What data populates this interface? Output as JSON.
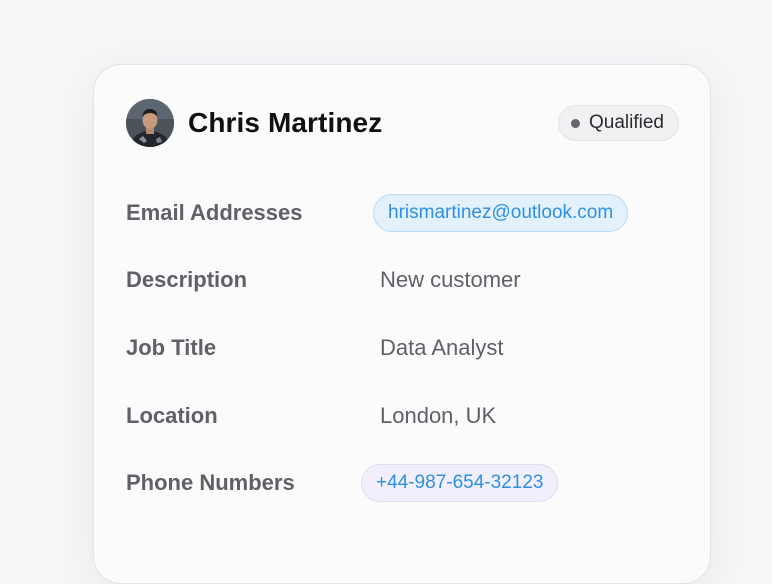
{
  "contact": {
    "name": "Chris Martinez",
    "status": "Qualified",
    "avatar_alt": "Chris Martinez profile photo"
  },
  "fields": {
    "email": {
      "label": "Email Addresses",
      "value": "hrismartinez@outlook.com"
    },
    "description": {
      "label": "Description",
      "value": "New customer"
    },
    "job_title": {
      "label": "Job Title",
      "value": "Data Analyst"
    },
    "location": {
      "label": "Location",
      "value": "London, UK"
    },
    "phone": {
      "label": "Phone Numbers",
      "value": "+44-987-654-32123"
    }
  },
  "colors": {
    "accent_link": "#2f8fe0",
    "status_dot": "#66666c"
  }
}
